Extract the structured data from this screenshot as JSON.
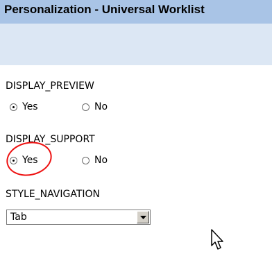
{
  "header": {
    "title": "Personalization - Universal Worklist"
  },
  "fields": [
    {
      "label": "DISPLAY_PREVIEW",
      "options": [
        {
          "label": "Yes",
          "checked": true
        },
        {
          "label": "No",
          "checked": false
        }
      ]
    },
    {
      "label": "DISPLAY_SUPPORT",
      "options": [
        {
          "label": "Yes",
          "checked": true
        },
        {
          "label": "No",
          "checked": false
        }
      ]
    }
  ],
  "style_navigation": {
    "label": "STYLE_NAVIGATION",
    "selected": "Tab"
  },
  "annotation": {
    "color": "#e11111"
  },
  "colors": {
    "title_bar": "#a9c4e6",
    "sub_bar": "#dce7f4"
  }
}
